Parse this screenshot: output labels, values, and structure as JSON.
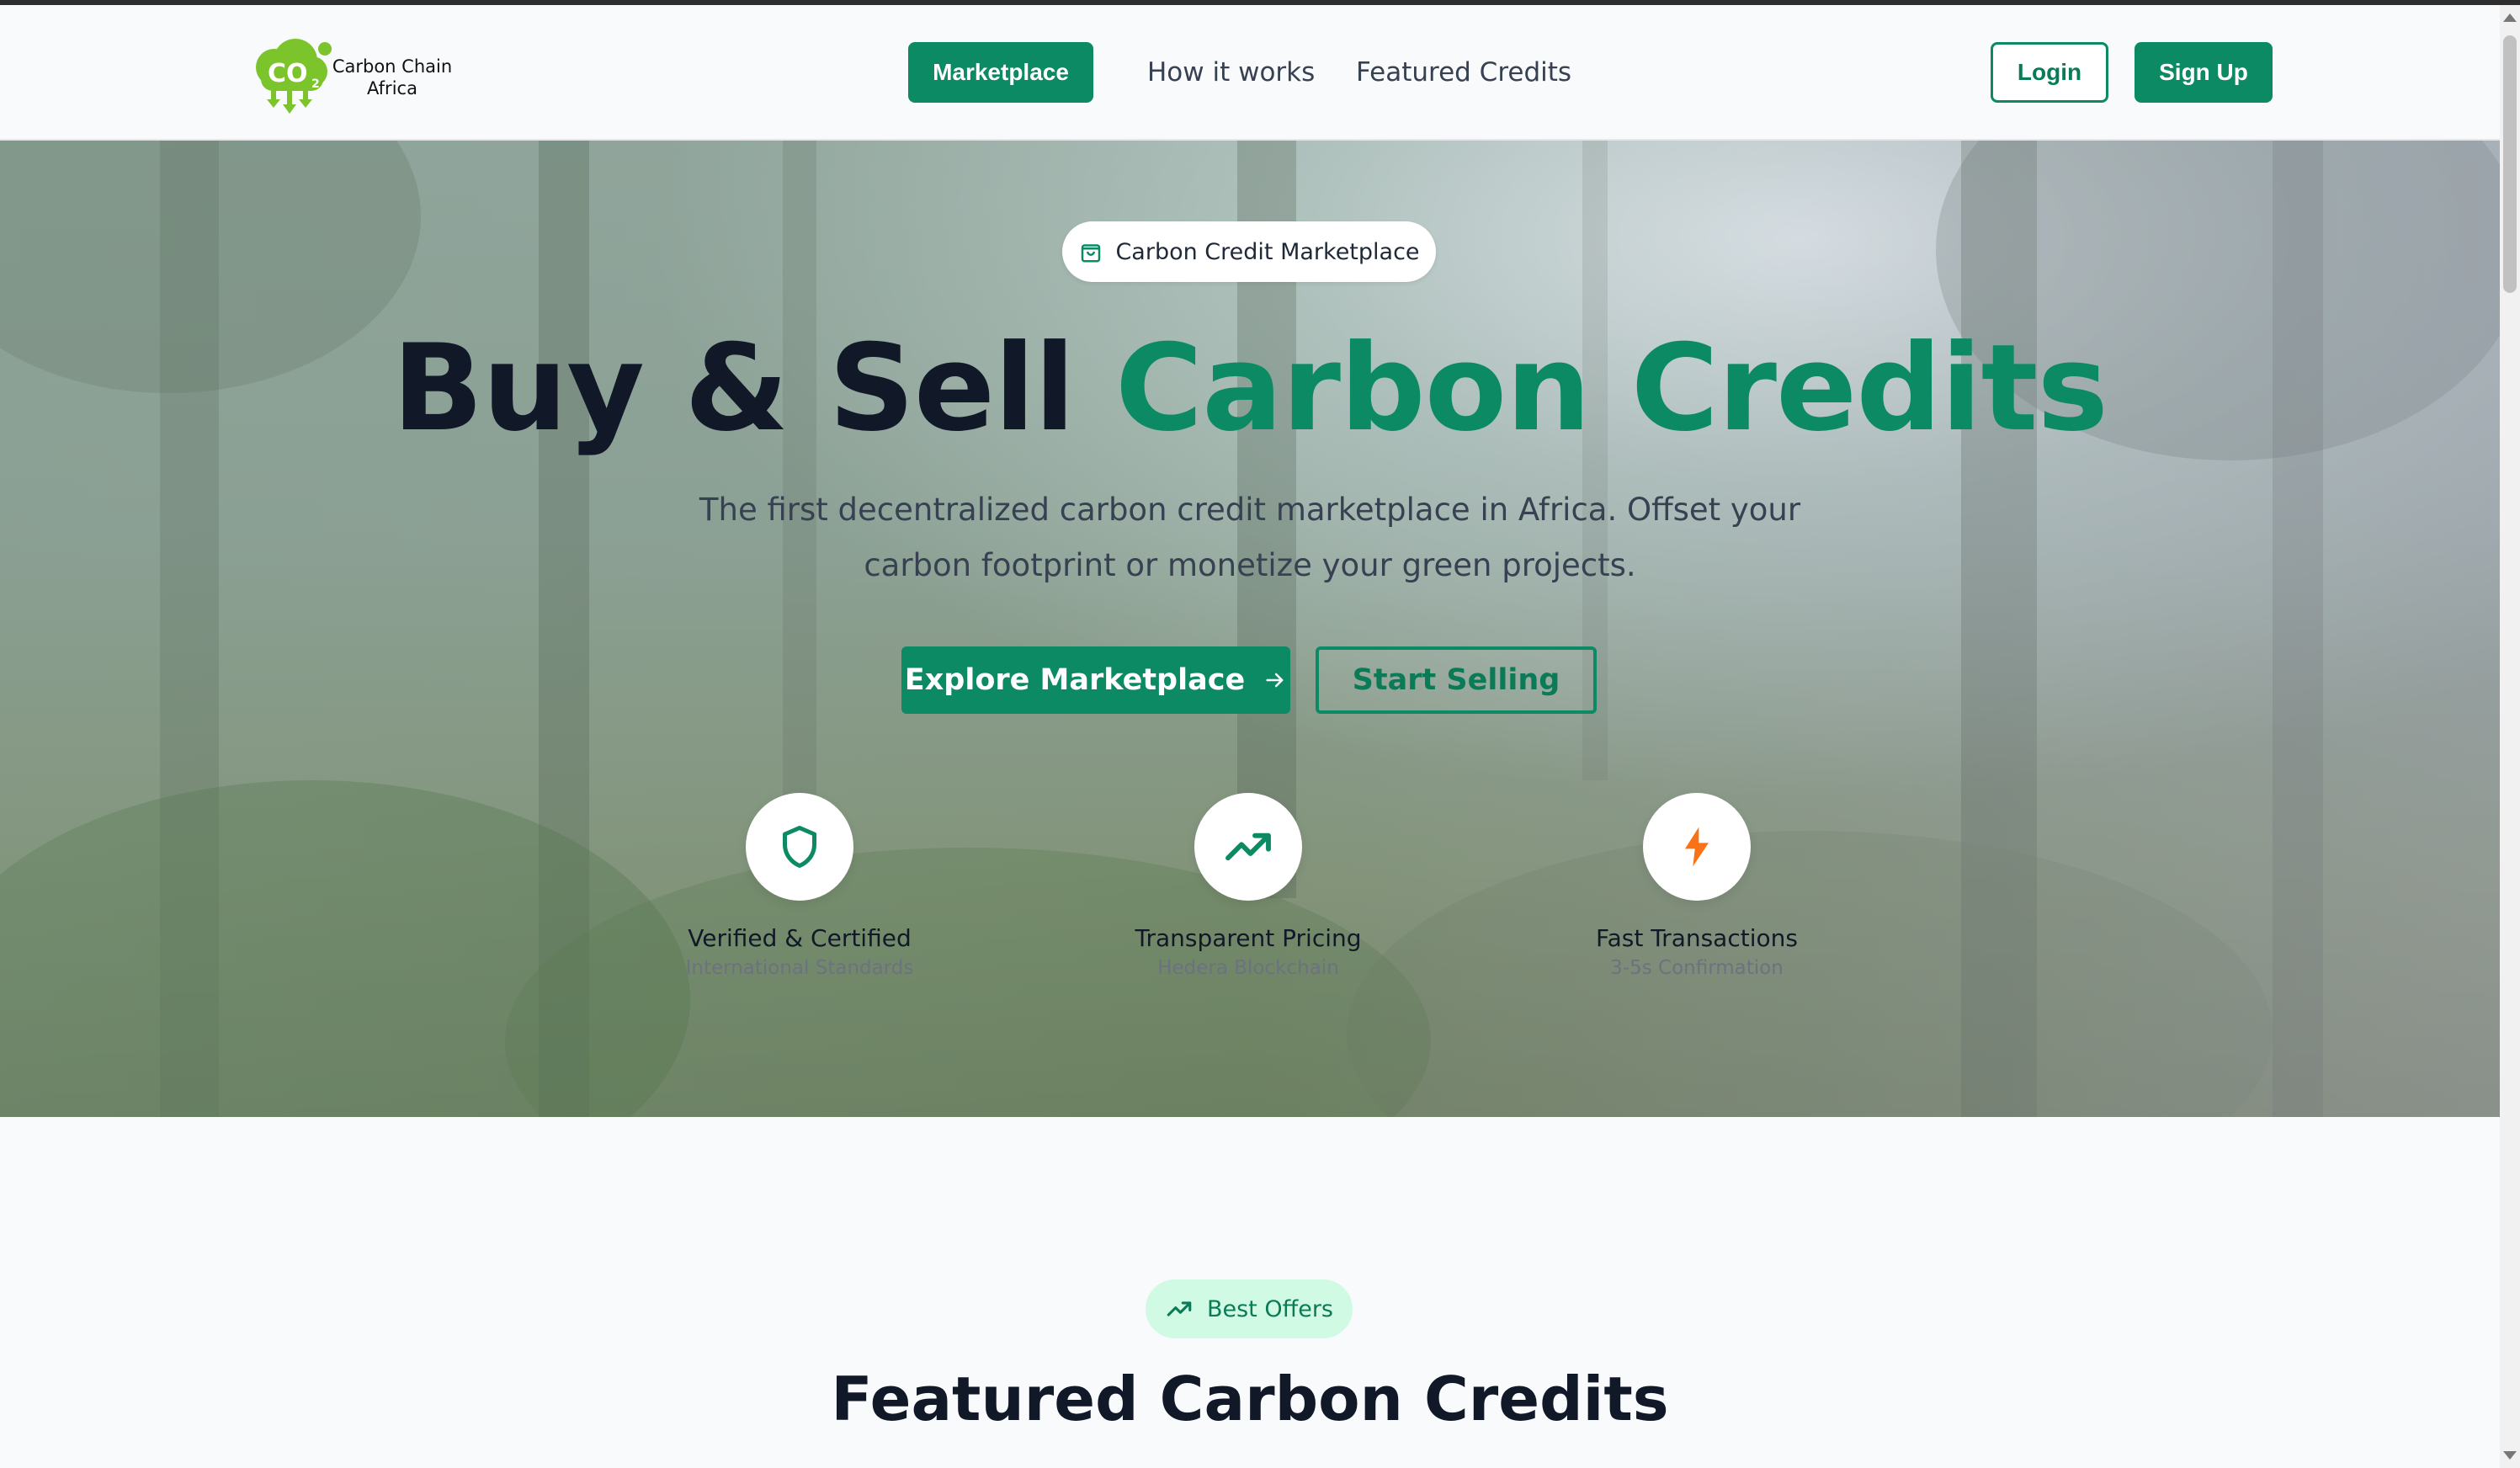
{
  "header": {
    "logo_text_line1": "Carbon Chain",
    "logo_text_line2": "Africa",
    "logo_mark_text": "CO",
    "logo_mark_sub": "2",
    "nav": {
      "marketplace": "Marketplace",
      "how_it_works": "How it works",
      "featured_credits": "Featured Credits"
    },
    "login": "Login",
    "signup": "Sign Up"
  },
  "hero": {
    "pill_label": "Carbon Credit Marketplace",
    "pill_icon": "shopping-bag-icon",
    "title_part1": "Buy & Sell ",
    "title_accent": "Carbon Credits",
    "subtitle_line1": "The first decentralized carbon credit marketplace in Africa. Offset your",
    "subtitle_line2": "carbon footprint or monetize your green projects.",
    "explore_button": "Explore Marketplace",
    "explore_icon": "arrow-right-icon",
    "sell_button": "Start Selling",
    "features": [
      {
        "icon": "shield-icon",
        "title": "Verified & Certified",
        "subtitle": "International Standards"
      },
      {
        "icon": "trending-up-icon",
        "title": "Transparent Pricing",
        "subtitle": "Hedera Blockchain"
      },
      {
        "icon": "lightning-icon",
        "title": "Fast Transactions",
        "subtitle": "3-5s Confirmation"
      }
    ]
  },
  "featured": {
    "badge": "Best Offers",
    "badge_icon": "trending-up-icon",
    "title": "Featured Carbon Credits"
  },
  "colors": {
    "brand": "#0b8a64",
    "accent_text": "#0b8a64",
    "badge_bg": "#d1fae5",
    "lightning": "#f97316"
  }
}
